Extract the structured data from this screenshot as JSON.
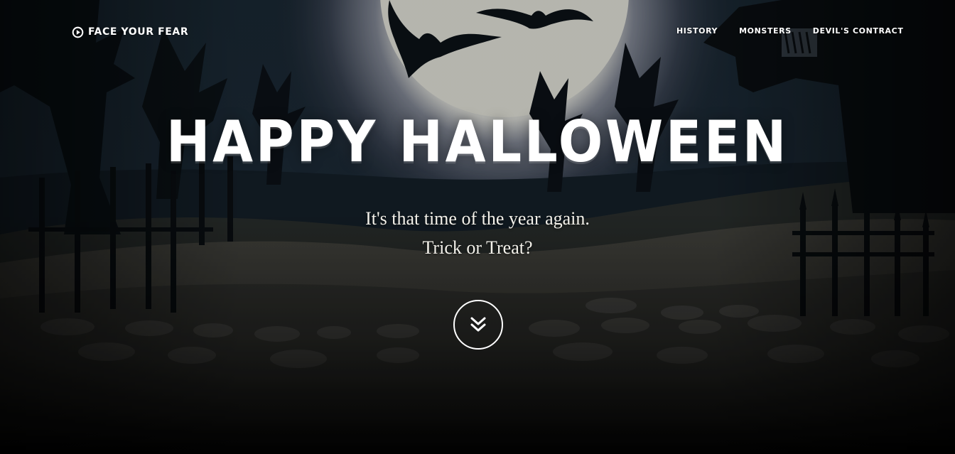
{
  "navbar": {
    "brand": {
      "label": "Face Your Fear",
      "icon": "play-circle-icon"
    },
    "links": [
      {
        "label": "History"
      },
      {
        "label": "Monsters"
      },
      {
        "label": "Devil's Contract"
      }
    ]
  },
  "hero": {
    "title": "Happy Halloween",
    "lines": [
      "It's that time of the year again.",
      "Trick or Treat?"
    ],
    "scroll_icon": "double-chevron-down-icon"
  },
  "colors": {
    "sky": "#1b2a36",
    "moon": "#f4f4ec",
    "ground_light": "#4a4a44",
    "ground_dark": "#0a0b0c",
    "text": "#ffffff"
  }
}
